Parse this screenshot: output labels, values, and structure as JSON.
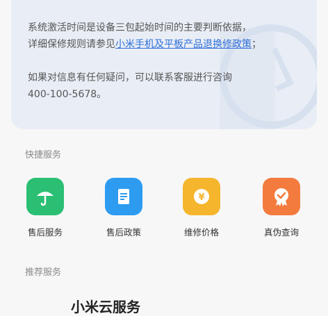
{
  "info": {
    "line_top_cut": "…",
    "para1_a": "系统激活时间是设备三包起始时间的主要判断依据，",
    "para1_b": "详细保修规则请参见",
    "para1_link": "小米手机及平板产品退换修政策",
    "para1_end": "；",
    "para2_a": "如果对信息有任何疑问，可以联系客服进行咨询",
    "para2_phone": "400-100-5678。"
  },
  "quick": {
    "title": "快捷服务",
    "items": [
      {
        "label": "售后服务",
        "icon": "umbrella-icon",
        "color": "#2bbf74"
      },
      {
        "label": "售后政策",
        "icon": "document-icon",
        "color": "#2d9bf0"
      },
      {
        "label": "维修价格",
        "icon": "yen-coin-icon",
        "color": "#f5b52c"
      },
      {
        "label": "真伪查询",
        "icon": "badge-check-icon",
        "color": "#f47b3e"
      }
    ]
  },
  "recommend": {
    "title": "推荐服务",
    "first_item": "小米云服务"
  }
}
